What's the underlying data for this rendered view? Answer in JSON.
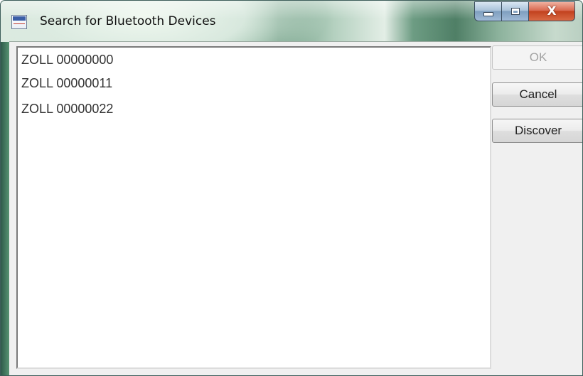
{
  "window": {
    "title": "Search for Bluetooth Devices",
    "close_glyph": "X",
    "icon": "zoll-app-icon"
  },
  "device_list": {
    "items": [
      "ZOLL 00000000",
      "ZOLL 00000011",
      "ZOLL 00000022"
    ]
  },
  "buttons": {
    "ok_label": "OK",
    "cancel_label": "Cancel",
    "discover_label": "Discover"
  },
  "colors": {
    "close_button": "#c2421f",
    "disabled_text": "#a3a3a3"
  }
}
